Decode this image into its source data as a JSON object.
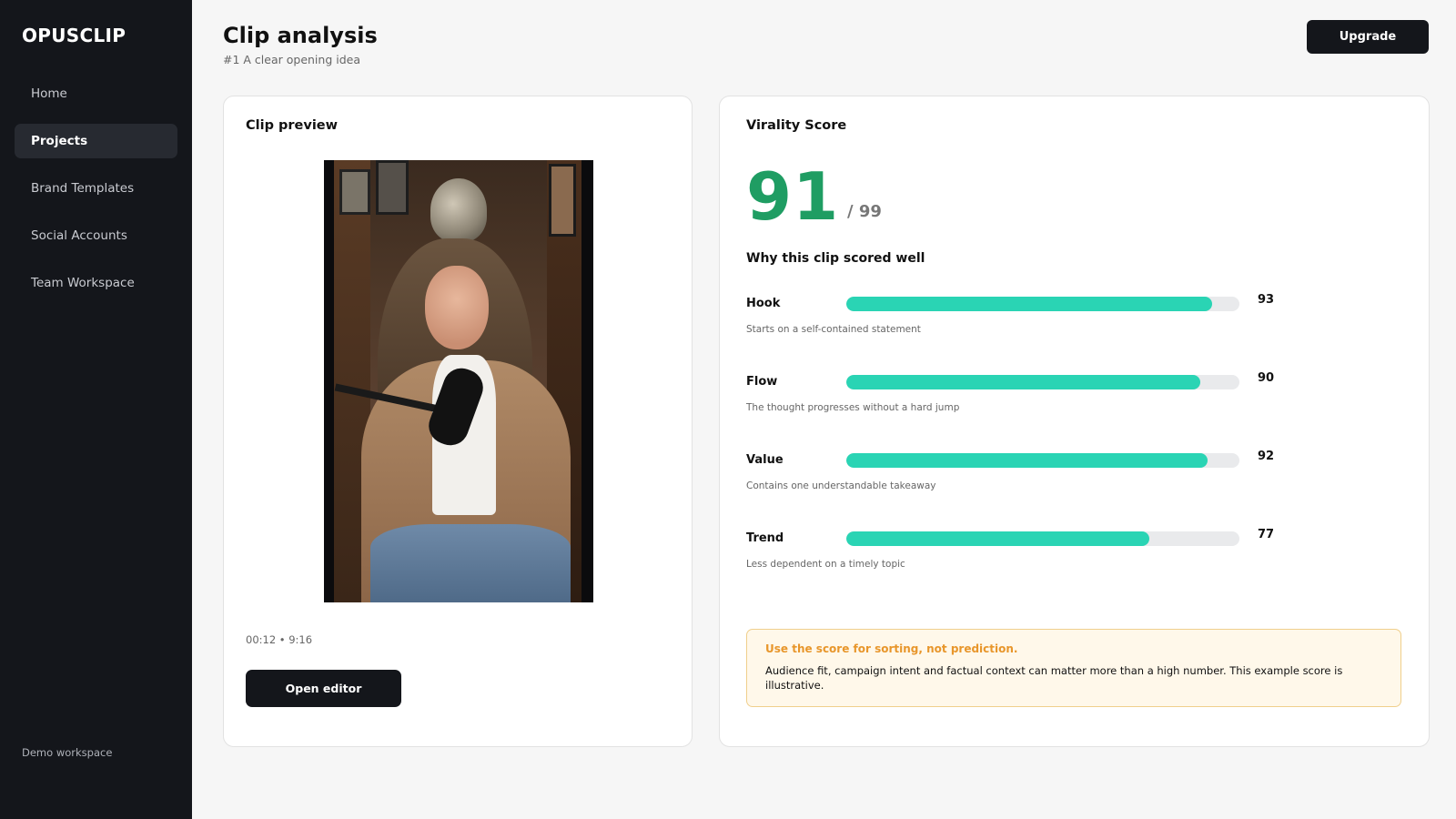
{
  "app": {
    "logo": "OPUSCLIP",
    "workspace": "Demo workspace"
  },
  "sidebar": {
    "items": [
      {
        "label": "Home",
        "active": false
      },
      {
        "label": "Projects",
        "active": true
      },
      {
        "label": "Brand Templates",
        "active": false
      },
      {
        "label": "Social Accounts",
        "active": false
      },
      {
        "label": "Team Workspace",
        "active": false
      }
    ]
  },
  "header": {
    "title": "Clip analysis",
    "subtitle": "#1 A clear opening idea",
    "upgrade_label": "Upgrade"
  },
  "preview": {
    "title": "Clip preview",
    "meta": "00:12 • 9:16",
    "open_editor_label": "Open editor"
  },
  "virality": {
    "title": "Virality Score",
    "score": "91",
    "max": "/ 99",
    "why_title": "Why this clip scored well",
    "metrics": [
      {
        "name": "Hook",
        "value": 93,
        "value_text": "93",
        "desc": "Starts on a self-contained statement"
      },
      {
        "name": "Flow",
        "value": 90,
        "value_text": "90",
        "desc": "The thought progresses without a hard jump"
      },
      {
        "name": "Value",
        "value": 92,
        "value_text": "92",
        "desc": "Contains one understandable takeaway"
      },
      {
        "name": "Trend",
        "value": 77,
        "value_text": "77",
        "desc": "Less dependent on a timely topic"
      }
    ],
    "note": {
      "title": "Use the score for sorting, not prediction.",
      "body": "Audience fit, campaign intent and factual context can matter more than a high number. This example score is illustrative."
    }
  },
  "colors": {
    "sidebar_bg": "#14161b",
    "score_green": "#1f9d63",
    "bar_fill": "#2ad4b4",
    "note_accent": "#e8962b"
  }
}
